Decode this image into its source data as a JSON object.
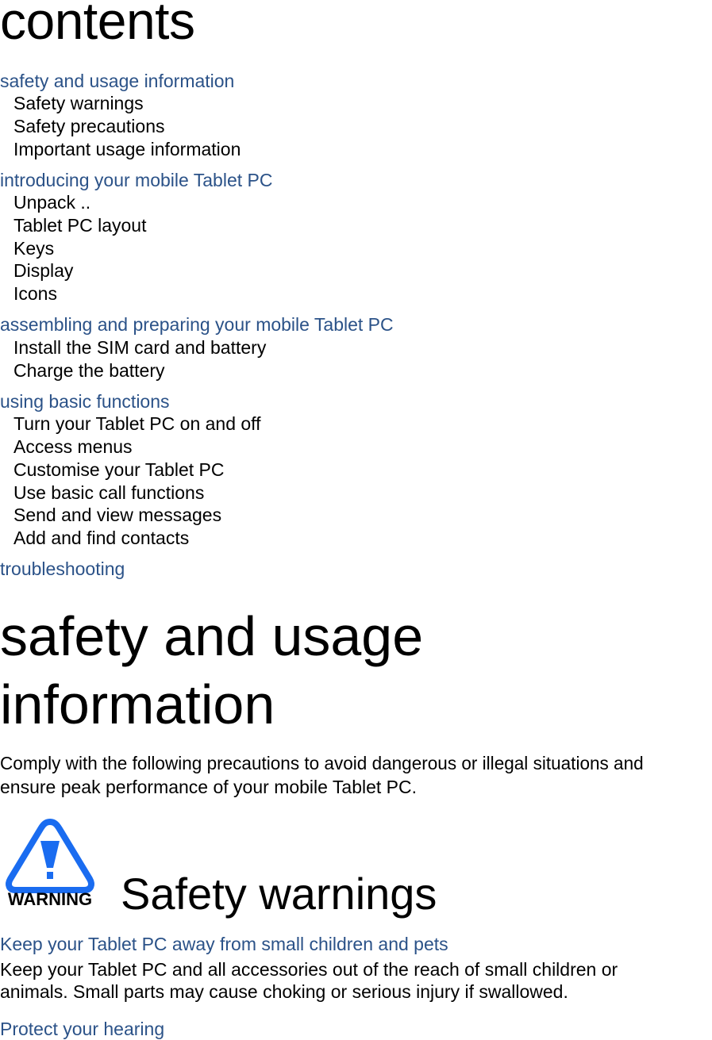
{
  "contents": {
    "title": "contents",
    "sections": [
      {
        "heading": "safety and usage information",
        "items": [
          "Safety warnings",
          "Safety precautions",
          "Important usage information"
        ]
      },
      {
        "heading": "introducing your mobile Tablet PC",
        "items": [
          "Unpack  ..",
          "Tablet PC layout",
          "Keys",
          "Display",
          "Icons"
        ]
      },
      {
        "heading": "assembling and preparing your mobile Tablet PC",
        "items": [
          "Install the SIM card and battery",
          "Charge the battery"
        ]
      },
      {
        "heading": "using basic functions",
        "items": [
          "Turn your Tablet PC on and off",
          "Access menus",
          "Customise your Tablet PC",
          "Use basic call functions",
          "Send and view messages",
          "Add and find contacts"
        ]
      },
      {
        "heading": "troubleshooting",
        "items": []
      }
    ]
  },
  "chapter": {
    "title_line1": "safety and usage",
    "title_line2": "information",
    "intro_line1": "Comply with the following precautions to avoid dangerous or illegal situations and",
    "intro_line2": "ensure peak performance of your mobile Tablet PC."
  },
  "warning_section": {
    "icon": "warning-triangle-icon",
    "icon_label": "WARNING",
    "icon_color": "#1a6cf0",
    "title": "Safety warnings",
    "subsections": [
      {
        "heading": "Keep your Tablet PC away from small children and pets",
        "body_line1": "Keep your Tablet PC and all accessories out of the reach of small children or",
        "body_line2": "animals. Small parts may cause choking or serious injury if swallowed."
      },
      {
        "heading": "Protect your hearing"
      }
    ]
  },
  "colors": {
    "heading_blue": "#2b5288",
    "text": "#000000",
    "background": "#ffffff"
  }
}
